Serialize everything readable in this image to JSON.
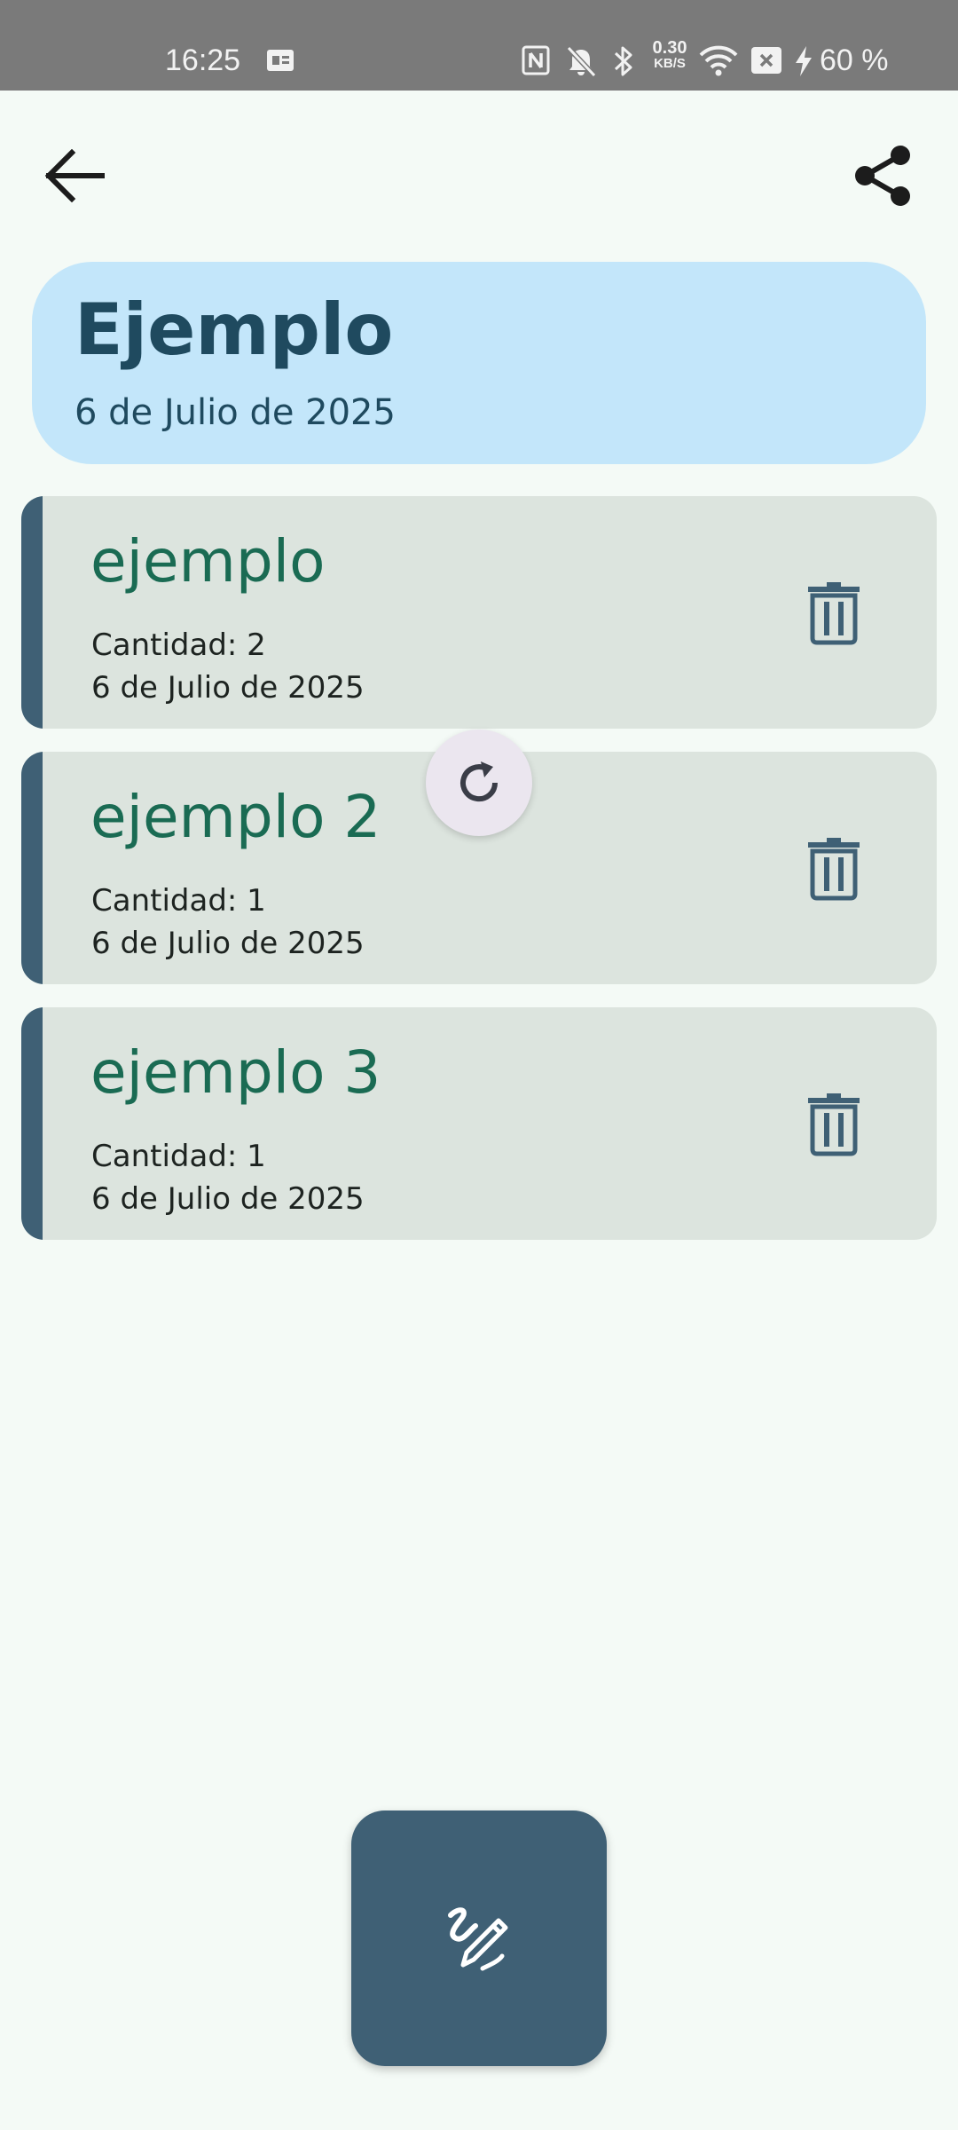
{
  "status_bar": {
    "time": "16:25",
    "network_speed": "0.30",
    "network_speed_unit": "KB/S",
    "battery": "60 %",
    "icons": [
      "sim-card-icon",
      "nfc-icon",
      "notifications-off-icon",
      "bluetooth-icon",
      "wifi-icon",
      "no-sim-icon",
      "charging-bolt-icon"
    ]
  },
  "app_bar": {
    "back_icon": "arrow-left-icon",
    "share_icon": "share-icon"
  },
  "header": {
    "title": "Ejemplo",
    "date": "6 de Julio de 2025"
  },
  "items": [
    {
      "name": "ejemplo",
      "quantity": "Cantidad: 2",
      "date": "6 de Julio de 2025"
    },
    {
      "name": "ejemplo 2",
      "quantity": "Cantidad: 1",
      "date": "6 de Julio de 2025"
    },
    {
      "name": "ejemplo 3",
      "quantity": "Cantidad: 1",
      "date": "6 de Julio de 2025"
    }
  ],
  "item_action_icon": "trash-icon",
  "refresh_icon": "refresh-icon",
  "fab_icon": "draw-pencil-icon",
  "colors": {
    "background": "#f4faf6",
    "status_bar": "#7a7a7a",
    "header_card": "#c3e6fa",
    "header_text": "#1f4a5f",
    "item_card": "#dce4de",
    "item_accent": "#3f6075",
    "item_name": "#1a6b53",
    "fab": "#3f6075"
  }
}
